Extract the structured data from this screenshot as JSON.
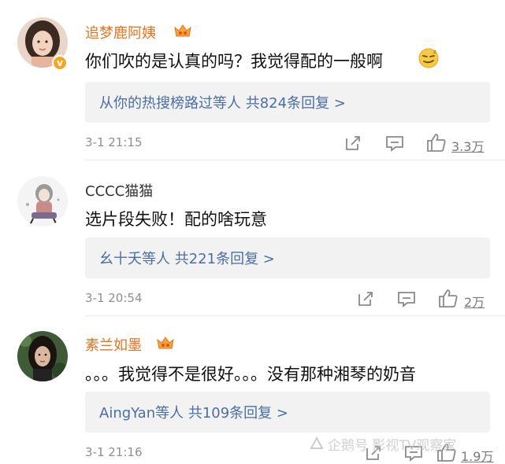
{
  "comments": [
    {
      "username": "追梦鹿阿姨",
      "avatar_icon": "avatar-photo-girl",
      "verified": true,
      "verified_label": "v",
      "text": "你们吹的是认真的吗？我觉得配的一般啊",
      "emoji": "smirk-emoji",
      "reply_summary": "从你的热搜榜路过等人  共824条回复 >",
      "time": "3-1 21:15",
      "like_count": "3.3万",
      "name_color": "#e8711f"
    },
    {
      "username": "CCCC猫猫",
      "avatar_icon": "avatar-illustration-cat-girl",
      "verified": false,
      "text": "选片段失败！配的啥玩意",
      "reply_summary": "幺十夭等人  共221条回复 >",
      "time": "3-1 20:54",
      "like_count": "2万",
      "name_color": "#333333"
    },
    {
      "username": "素兰如墨",
      "avatar_icon": "avatar-photo-woman-dark",
      "verified": false,
      "text": "。。。我觉得不是很好。。。没有那种湘琴的奶音",
      "reply_summary": "AingYan等人  共109条回复 >",
      "time": "3-1 21:16",
      "like_count": "1.9万",
      "name_color": "#e8711f"
    }
  ],
  "watermark": "企鹅号 影视TV观察家",
  "colors": {
    "accent_link": "#4a6fa5",
    "vip_name": "#e8711f",
    "reply_bg": "#f2f2f2"
  }
}
